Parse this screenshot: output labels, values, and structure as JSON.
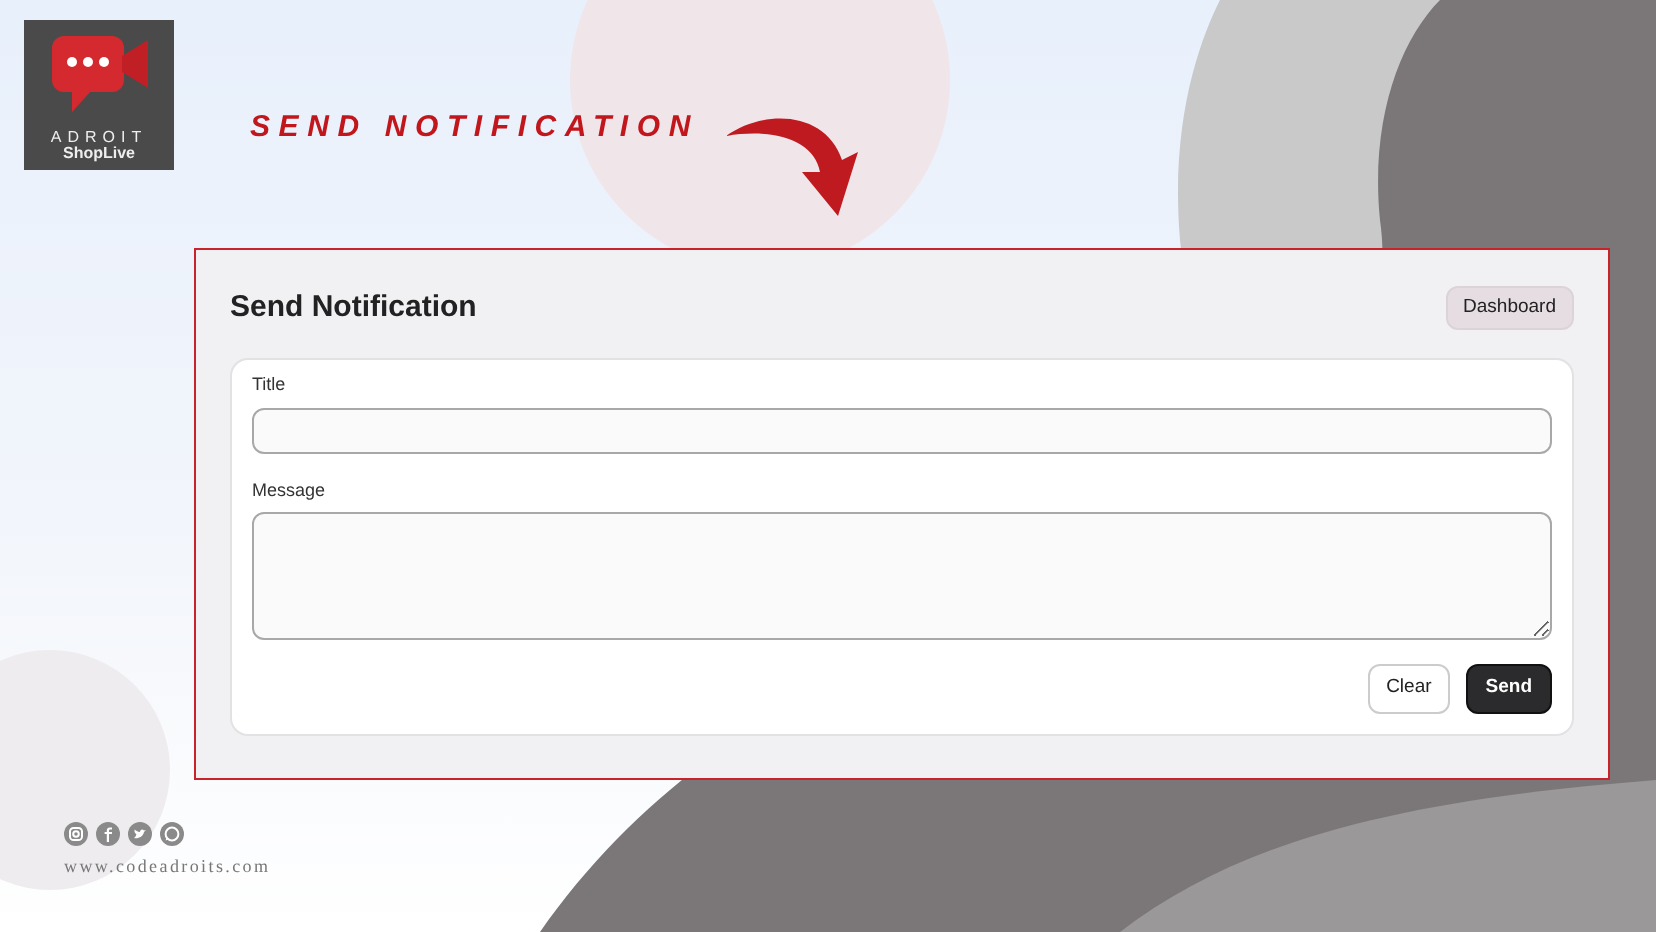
{
  "logo": {
    "name": "ADROIT",
    "tagline": "ShopLive"
  },
  "headline": "SEND NOTIFICATION",
  "panel": {
    "title": "Send Notification",
    "dashboard_button": "Dashboard",
    "fields": [
      {
        "label": "Title",
        "kind": "input"
      },
      {
        "label": "Message",
        "kind": "textarea"
      }
    ],
    "buttons": [
      {
        "label": "Clear",
        "kind": "outline"
      },
      {
        "label": "Send",
        "kind": "primary"
      }
    ]
  },
  "footer": {
    "website": "www.codeadroits.com"
  }
}
